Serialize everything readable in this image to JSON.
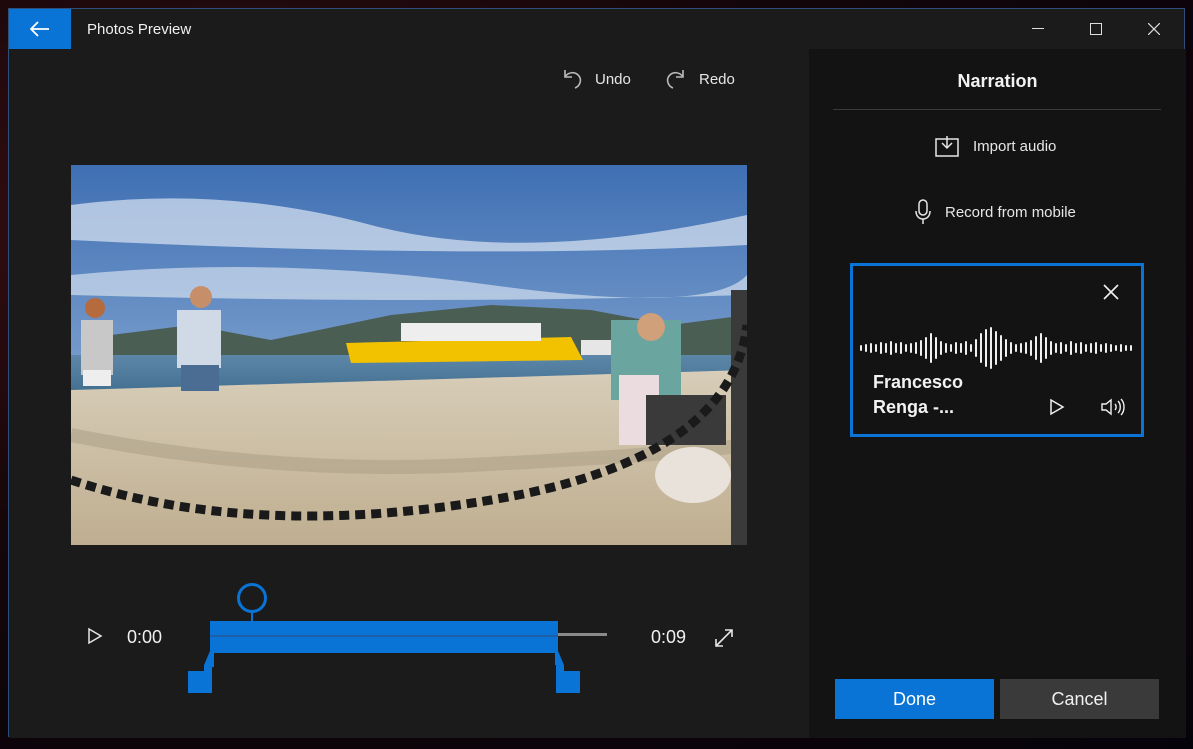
{
  "window": {
    "title": "Photos Preview"
  },
  "toolbar": {
    "undo_label": "Undo",
    "redo_label": "Redo"
  },
  "timeline": {
    "start_time": "0:00",
    "end_time": "0:09"
  },
  "panel": {
    "title": "Narration",
    "import_label": "Import audio",
    "record_label": "Record from mobile",
    "audio_clip": {
      "name": "Francesco Renga -..."
    },
    "done_label": "Done",
    "cancel_label": "Cancel"
  },
  "colors": {
    "accent": "#0a74d6",
    "window_bg": "#1b1b1b",
    "panel_bg": "#131313"
  }
}
